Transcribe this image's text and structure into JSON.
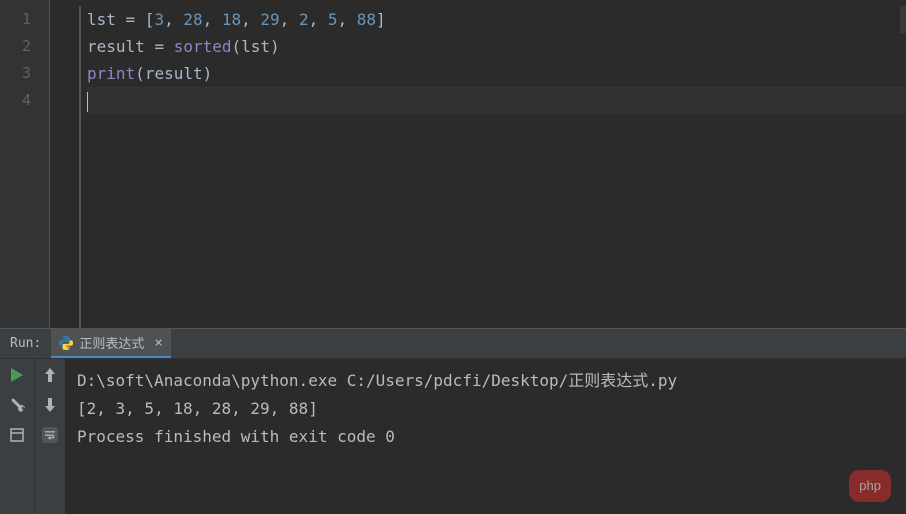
{
  "editor": {
    "lines": [
      {
        "num": "1"
      },
      {
        "num": "2"
      },
      {
        "num": "3"
      },
      {
        "num": "4"
      }
    ],
    "code": {
      "l1": {
        "var": "lst ",
        "eq": "= ",
        "lb": "[",
        "n1": "3",
        "c1": ", ",
        "n2": "28",
        "c2": ", ",
        "n3": "18",
        "c3": ", ",
        "n4": "29",
        "c4": ", ",
        "n5": "2",
        "c5": ", ",
        "n6": "5",
        "c6": ", ",
        "n7": "88",
        "rb": "]"
      },
      "l2": {
        "var": "result ",
        "eq": "= ",
        "fn": "sorted",
        "lp": "(",
        "arg": "lst",
        "rp": ")"
      },
      "l3": {
        "fn": "print",
        "lp": "(",
        "arg": "result",
        "rp": ")"
      }
    }
  },
  "run": {
    "label": "Run:",
    "tab": {
      "name": "正则表达式",
      "close": "×"
    }
  },
  "console": {
    "line1": "D:\\soft\\Anaconda\\python.exe C:/Users/pdcfi/Desktop/正则表达式.py",
    "line2": "[2, 3, 5, 18, 28, 29, 88]",
    "line3": "",
    "line4": "Process finished with exit code 0"
  },
  "watermark": "php"
}
